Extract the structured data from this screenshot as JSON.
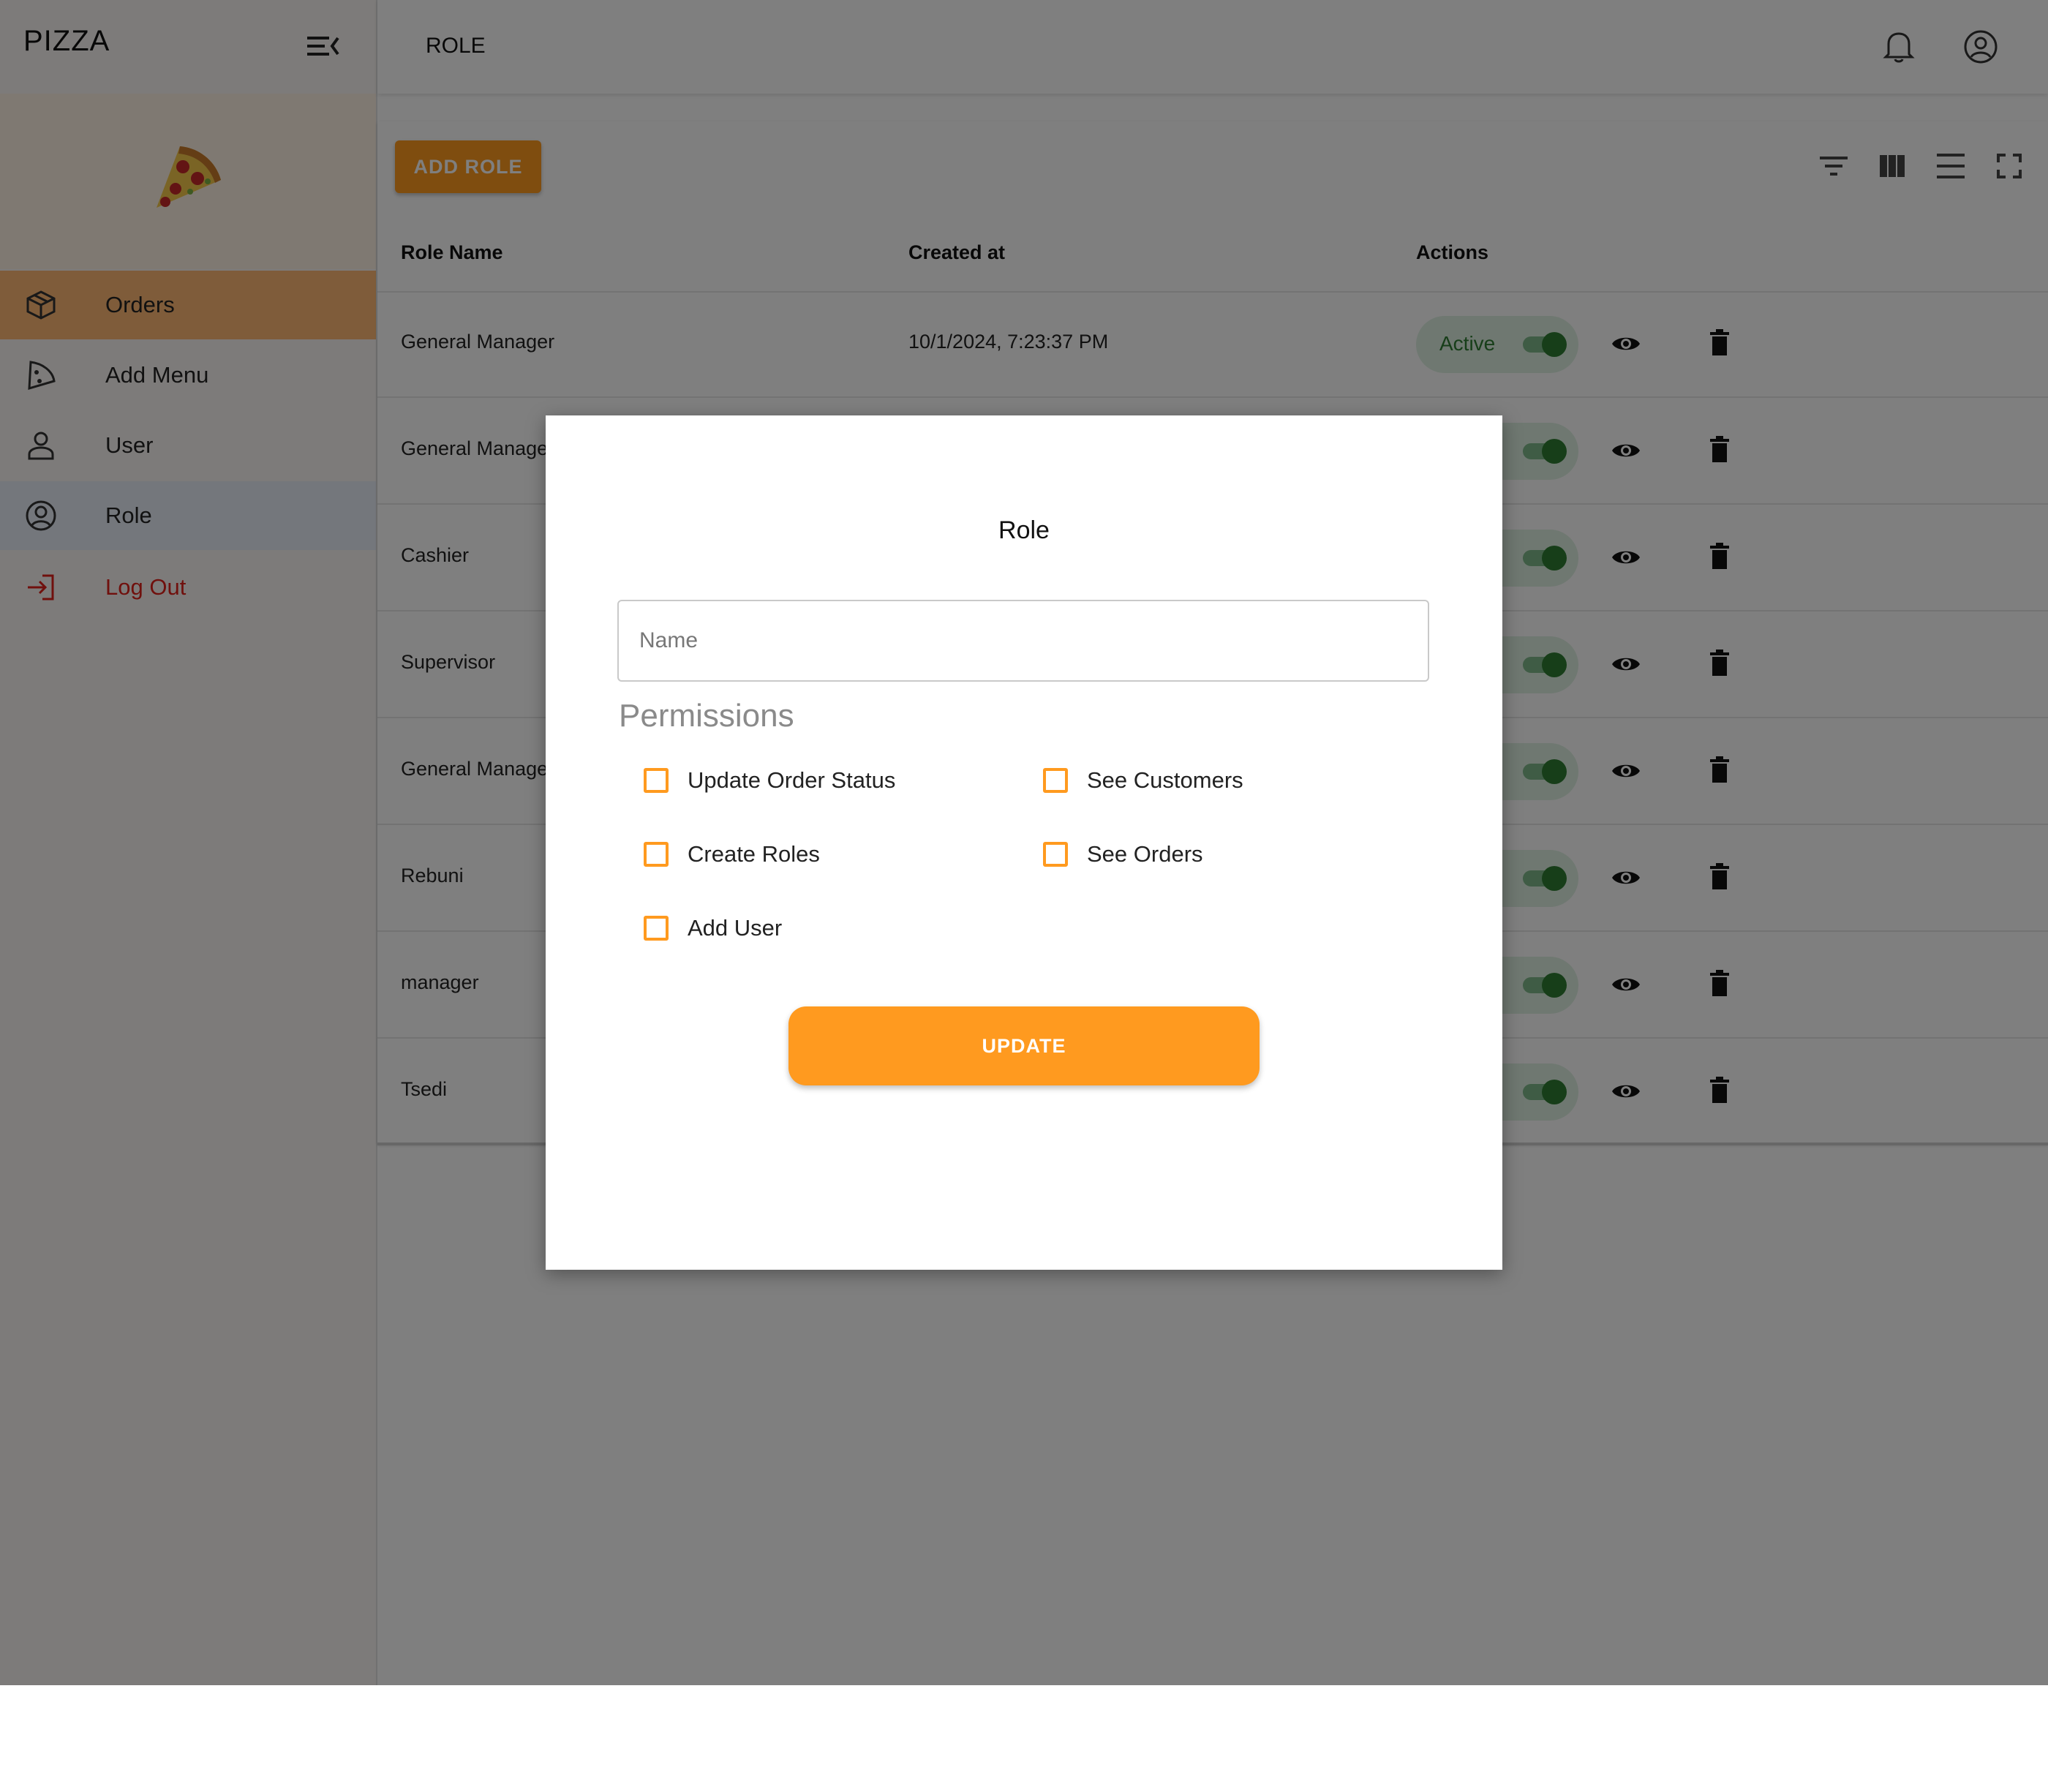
{
  "app": {
    "brand": "PIZZA",
    "page_title": "ROLE"
  },
  "sidebar": {
    "items": [
      {
        "label": "Orders",
        "icon": "box-icon"
      },
      {
        "label": "Add Menu",
        "icon": "pizza-slice-outline-icon"
      },
      {
        "label": "User",
        "icon": "person-icon"
      },
      {
        "label": "Role",
        "icon": "account-circle-icon"
      },
      {
        "label": "Log Out",
        "icon": "logout-icon"
      }
    ],
    "active_item": "Orders",
    "selected_item": "Role"
  },
  "toolbar": {
    "add_role_label": "ADD ROLE"
  },
  "table": {
    "columns": [
      "Role Name",
      "Created at",
      "Actions"
    ],
    "rows": [
      {
        "name": "General Manager",
        "created_at": "10/1/2024, 7:23:37 PM",
        "status": "Active"
      },
      {
        "name": "General Manager",
        "created_at": "",
        "status": ""
      },
      {
        "name": "Cashier",
        "created_at": "",
        "status": ""
      },
      {
        "name": "Supervisor",
        "created_at": "",
        "status": ""
      },
      {
        "name": "General Manager",
        "created_at": "",
        "status": ""
      },
      {
        "name": "Rebuni",
        "created_at": "",
        "status": ""
      },
      {
        "name": "manager",
        "created_at": "",
        "status": ""
      },
      {
        "name": "Tsedi",
        "created_at": "",
        "status": ""
      }
    ]
  },
  "modal": {
    "title": "Role",
    "name_placeholder": "Name",
    "name_value": "",
    "permissions_heading": "Permissions",
    "permissions": [
      {
        "label": "Update Order Status",
        "checked": false
      },
      {
        "label": "See Customers",
        "checked": false
      },
      {
        "label": "Create Roles",
        "checked": false
      },
      {
        "label": "See Orders",
        "checked": false
      },
      {
        "label": "Add User",
        "checked": false
      }
    ],
    "submit_label": "UPDATE"
  },
  "colors": {
    "accent": "#ff9a1f",
    "active_nav": "#ffb974",
    "status_green": "#2e7d32",
    "logout_red": "#e0201a"
  }
}
